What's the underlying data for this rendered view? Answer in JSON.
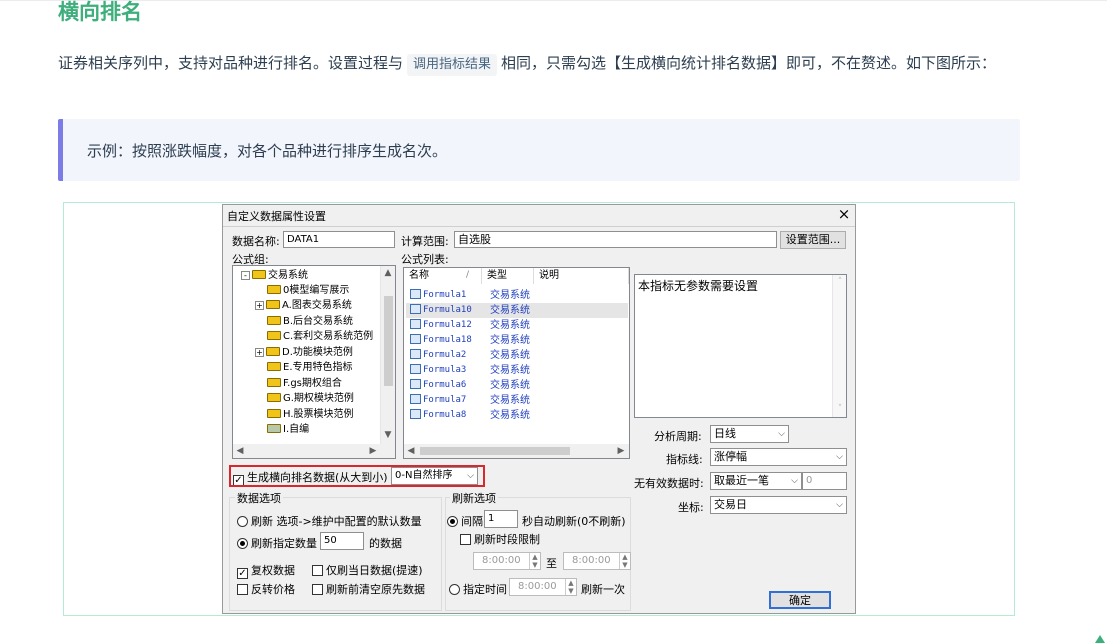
{
  "doc": {
    "heading": "横向排名",
    "para_part1": "证券相关序列中，支持对品种进行排名。设置过程与",
    "para_code": "调用指标结果",
    "para_part2": "相同，只需勾选【生成横向统计排名数据】即可，不在赘述。如下图所示：",
    "tip": "示例：按照涨跌幅度，对各个品种进行排序生成名次。"
  },
  "dialog": {
    "title": "自定义数据属性设置",
    "close": "×",
    "data_name_label": "数据名称:",
    "data_name_value": "DATA1",
    "calc_range_label": "计算范围:",
    "calc_range_value": "自选股",
    "set_range_button": "设置范围...",
    "formula_group_label": "公式组:",
    "formula_list_label": "公式列表:",
    "tree": [
      {
        "label": "交易系统",
        "expander": "-"
      },
      {
        "label": "0模型编写展示",
        "expander": ""
      },
      {
        "label": "A.图表交易系统",
        "expander": "+"
      },
      {
        "label": "B.后台交易系统",
        "expander": ""
      },
      {
        "label": "C.套利交易系统范例",
        "expander": ""
      },
      {
        "label": "D.功能模块范例",
        "expander": "+"
      },
      {
        "label": "E.专用特色指标",
        "expander": ""
      },
      {
        "label": "F.gs期权组合",
        "expander": ""
      },
      {
        "label": "G.期权模块范例",
        "expander": ""
      },
      {
        "label": "H.股票模块范例",
        "expander": ""
      },
      {
        "label": "I.自编",
        "expander": ""
      }
    ],
    "columns": [
      "名称",
      "类型",
      "说明"
    ],
    "formulas": [
      {
        "name": "Formula1",
        "type": "交易系统"
      },
      {
        "name": "Formula10",
        "type": "交易系统"
      },
      {
        "name": "Formula12",
        "type": "交易系统"
      },
      {
        "name": "Formula18",
        "type": "交易系统"
      },
      {
        "name": "Formula2",
        "type": "交易系统"
      },
      {
        "name": "Formula3",
        "type": "交易系统"
      },
      {
        "name": "Formula6",
        "type": "交易系统"
      },
      {
        "name": "Formula7",
        "type": "交易系统"
      },
      {
        "name": "Formula8",
        "type": "交易系统"
      }
    ],
    "param_text": "本指标无参数需要设置",
    "period_label": "分析周期:",
    "period_value": "日线",
    "indicator_label": "指标线:",
    "indicator_value": "涨停幅",
    "invalid_label": "无有效数据时:",
    "invalid_value": "取最近一笔",
    "invalid_num": "0",
    "coord_label": "坐标:",
    "coord_value": "交易日",
    "rank_checkbox_label": "生成横向排名数据(从大到小)",
    "rank_order_value": "0-N自然排序",
    "data_options_label": "数据选项",
    "opt_refresh_default": "刷新 选项->维护中配置的默认数量",
    "opt_refresh_count": "刷新指定数量",
    "opt_refresh_count_value": "50",
    "opt_refresh_count_suffix": "的数据",
    "chk_fq": "复权数据",
    "chk_today": "仅刷当日数据(提速)",
    "chk_reverse": "反转价格",
    "chk_clear": "刷新前清空原先数据",
    "refresh_options_label": "刷新选项",
    "interval_label": "间隔",
    "interval_value": "1",
    "interval_suffix": "秒自动刷新(0不刷新)",
    "chk_time_limit": "刷新时段限制",
    "time_start": "8:00:00",
    "time_to": "至",
    "time_end": "8:00:00",
    "fixed_time_label": "指定时间",
    "fixed_time_value": "8:00:00",
    "fixed_time_suffix": "刷新一次",
    "ok_button": "确定"
  },
  "colors": {
    "heading": "#3eaf7c",
    "tip_border": "#7b7ce6",
    "highlight": "#d9272e"
  }
}
